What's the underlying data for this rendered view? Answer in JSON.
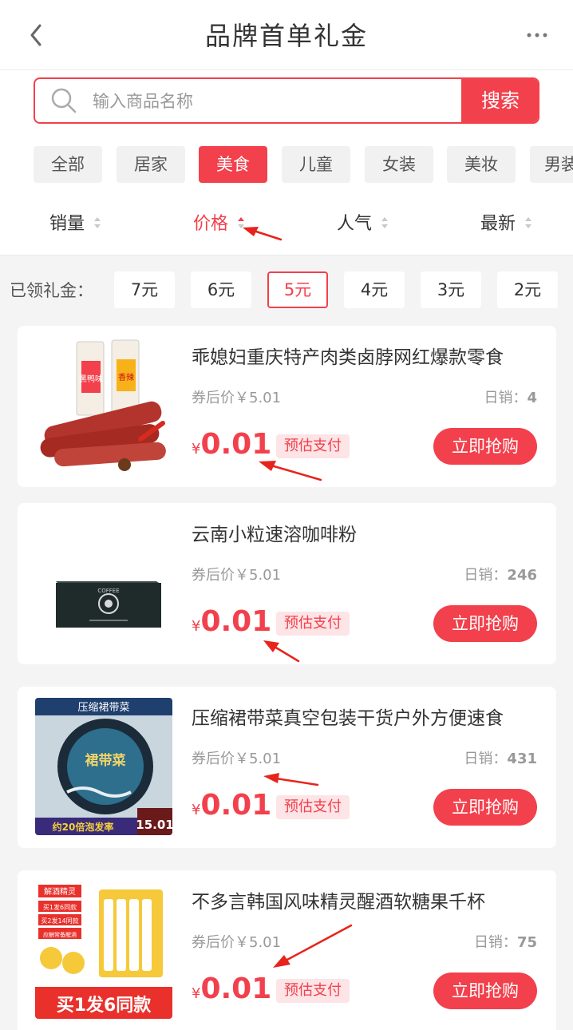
{
  "header": {
    "title": "品牌首单礼金"
  },
  "search": {
    "placeholder": "输入商品名称",
    "button_label": "搜索"
  },
  "categories": [
    {
      "label": "全部"
    },
    {
      "label": "居家"
    },
    {
      "label": "美食"
    },
    {
      "label": "儿童"
    },
    {
      "label": "女装"
    },
    {
      "label": "美妆"
    },
    {
      "label": "男装"
    }
  ],
  "sorts": [
    {
      "label": "销量"
    },
    {
      "label": "价格"
    },
    {
      "label": "人气"
    },
    {
      "label": "最新"
    }
  ],
  "coupons": {
    "label": "已领礼金：",
    "options": [
      "7元",
      "6元",
      "5元",
      "4元",
      "3元",
      "2元"
    ]
  },
  "products": [
    {
      "name": "乖媳妇重庆特产肉类卤脖网红爆款零食",
      "after_price": "券后价￥5.01",
      "sales_label": "日销：",
      "sales": "4",
      "currency": "¥",
      "price": "0.01",
      "tag": "预估支付",
      "buy_label": "立即抢购"
    },
    {
      "name": "云南小粒速溶咖啡粉",
      "after_price": "券后价￥5.01",
      "sales_label": "日销：",
      "sales": "246",
      "currency": "¥",
      "price": "0.01",
      "tag": "预估支付",
      "buy_label": "立即抢购"
    },
    {
      "name": "压缩裙带菜真空包装干货户外方便速食",
      "after_price": "券后价￥5.01",
      "sales_label": "日销：",
      "sales": "431",
      "currency": "¥",
      "price": "0.01",
      "tag": "预估支付",
      "buy_label": "立即抢购"
    },
    {
      "name": "不多言韩国风味精灵醒酒软糖果千杯",
      "after_price": "券后价￥5.01",
      "sales_label": "日销：",
      "sales": "75",
      "currency": "¥",
      "price": "0.01",
      "tag": "预估支付",
      "buy_label": "立即抢购"
    }
  ],
  "thumb_labels": {
    "p1_a": "黑鸭味",
    "p1_b": "香辣",
    "p2_brand": "COFFEE",
    "p3_header": "压缩裙带菜",
    "p3_title": "裙带菜",
    "p3_footer": "约20倍泡发率",
    "p3_price": "15.01",
    "p4_tag1": "解酒精灵",
    "p4_tag2": "买1发6同款",
    "p4_tag3": "买2发14同款",
    "p4_tag4": "应酬常备醒酒",
    "p4_banner": "买1发6同款"
  },
  "colors": {
    "accent": "#f2404c",
    "tag_bg": "#fde4e6"
  }
}
